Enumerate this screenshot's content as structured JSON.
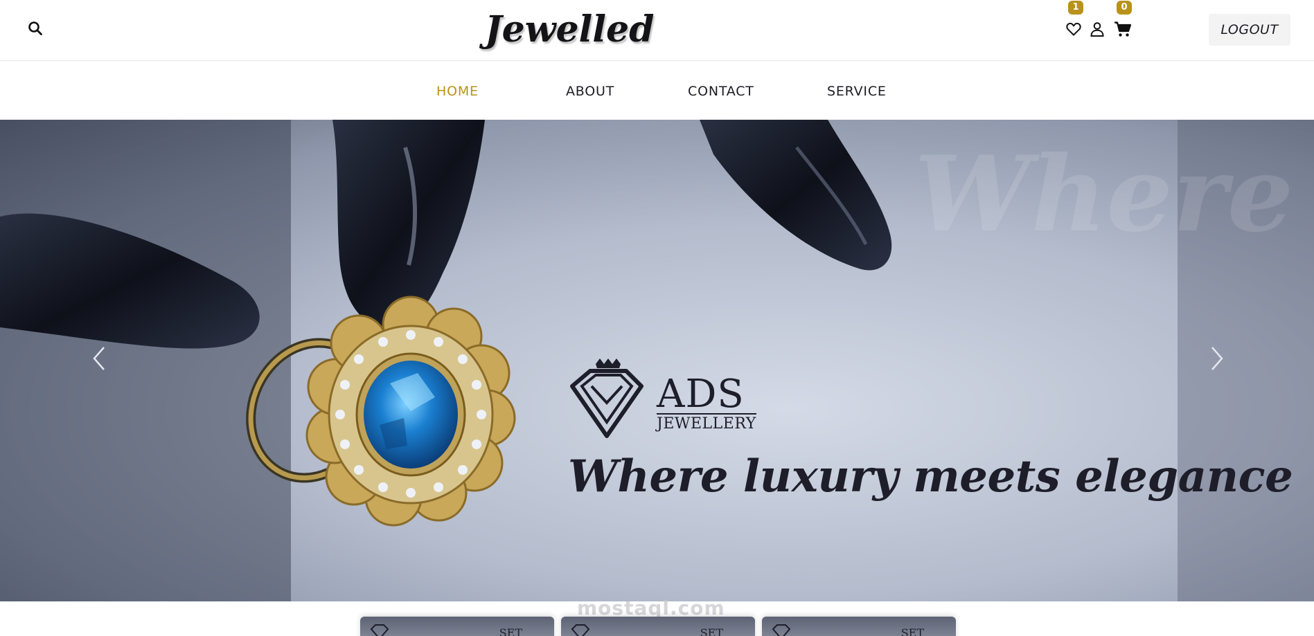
{
  "header": {
    "brand": "Jewelled",
    "wishlist_count": "1",
    "cart_count": "0",
    "logout_label": "LOGOUT",
    "icons": [
      "search-icon",
      "heart-icon",
      "user-icon",
      "cart-icon"
    ]
  },
  "nav": {
    "items": [
      {
        "label": "HOME",
        "active": true
      },
      {
        "label": "ABOUT",
        "active": false
      },
      {
        "label": "CONTACT",
        "active": false
      },
      {
        "label": "SERVICE",
        "active": false
      }
    ]
  },
  "hero": {
    "logo_top": "ADS",
    "logo_bottom": "JEWELLERY",
    "tagline": "Where luxury meets elegance",
    "watermark": "Where"
  },
  "cards": [
    {
      "label": "SET"
    },
    {
      "label": "SET"
    },
    {
      "label": "SET"
    }
  ],
  "footer_watermark": "mostaql.com",
  "colors": {
    "accent": "#b8921a",
    "text": "#1c1c24",
    "hero_background": "#b4bccd"
  }
}
